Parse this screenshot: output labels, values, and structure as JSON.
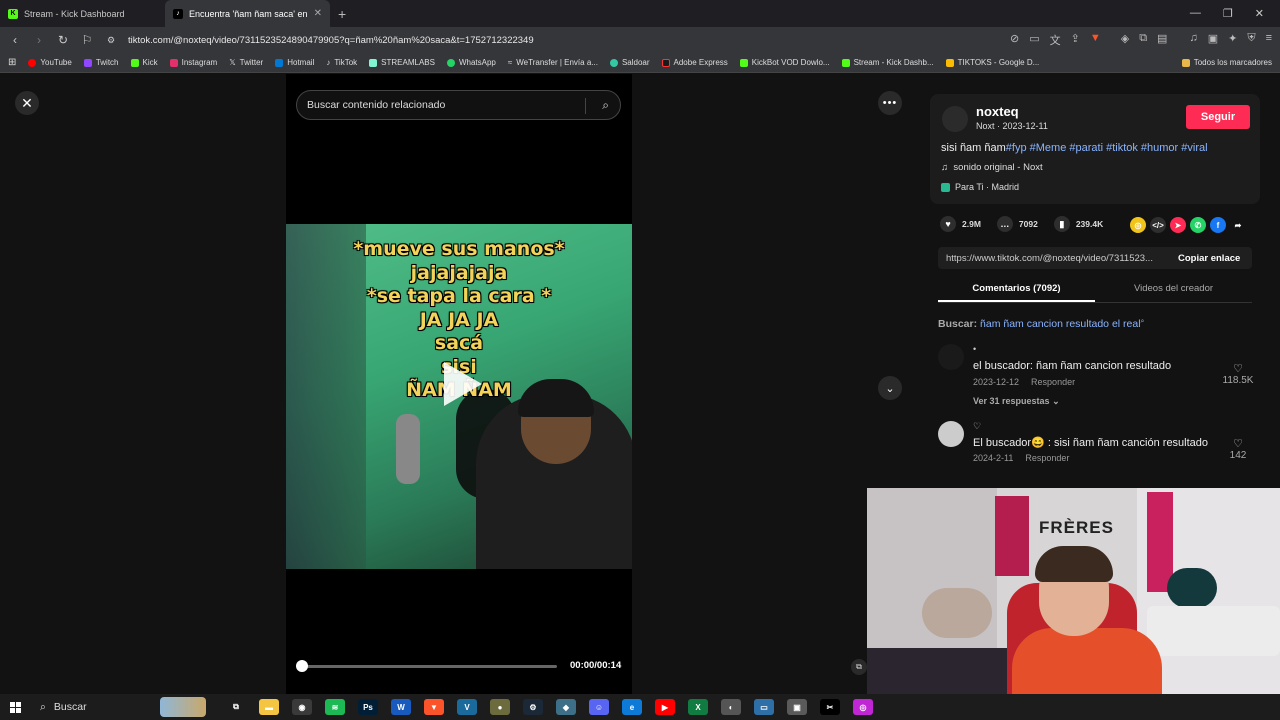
{
  "browser": {
    "tabs": [
      {
        "label": "Stream - Kick Dashboard",
        "active": false,
        "favicon_color": "#53fc18",
        "favicon_glyph": "K"
      },
      {
        "label": "Encuentra 'ñam ñam saca' en Tik",
        "active": true,
        "favicon_color": "#000000",
        "favicon_glyph": "♪"
      }
    ],
    "new_tab_glyph": "+",
    "url": "tiktok.com/@noxteq/video/7311523524890479905?q=ñam%20ñam%20saca&t=1752712322349",
    "bookmarks": [
      {
        "label": "YouTube",
        "color": "#ff0000"
      },
      {
        "label": "Twitch",
        "color": "#9146ff"
      },
      {
        "label": "Kick",
        "color": "#53fc18"
      },
      {
        "label": "Instagram",
        "color": "#e1306c"
      },
      {
        "label": "Twitter",
        "color": "#ffffff"
      },
      {
        "label": "Hotmail",
        "color": "#0078d4"
      },
      {
        "label": "TikTok",
        "color": "#ffffff"
      },
      {
        "label": "STREAMLABS",
        "color": "#80f5d2"
      },
      {
        "label": "WhatsApp",
        "color": "#25d366"
      },
      {
        "label": "WeTransfer | Envía a...",
        "color": "#ffffff"
      },
      {
        "label": "Saldoar",
        "color": "#35c7a3"
      },
      {
        "label": "Adobe Express",
        "color": "#ff0000"
      },
      {
        "label": "KickBot VOD Dowlo...",
        "color": "#53fc18"
      },
      {
        "label": "Stream - Kick Dashb...",
        "color": "#53fc18"
      },
      {
        "label": "TIKTOKS - Google D...",
        "color": "#fbbc04"
      }
    ],
    "bookmarks_folder": "Todos los marcadores"
  },
  "search": {
    "placeholder": "Buscar contenido relacionado"
  },
  "video": {
    "caption_lines": [
      "*mueve sus manos*",
      "jajajajaja",
      "*se tapa la cara *",
      "JA JA JA",
      "sacá",
      "sisi",
      "ÑAM ÑAM"
    ],
    "time": "00:00/00:14",
    "progress": 0.0
  },
  "author": {
    "username": "noxteq",
    "sub": "Noxt · 2023-12-11",
    "follow_label": "Seguir",
    "description_text": "sisi ñam ñam",
    "description_tags": "#fyp #Meme #parati #tiktok #humor #viral",
    "sound": "sonido original - Noxt",
    "location": "Para Ti · Madrid"
  },
  "stats": {
    "likes": "2.9M",
    "comments": "7092",
    "saves": "239.4K"
  },
  "share_icons": [
    {
      "name": "coin-icon",
      "color": "#f0c419",
      "glyph": "◎"
    },
    {
      "name": "embed-icon",
      "color": "#2e2e2e",
      "glyph": "</>"
    },
    {
      "name": "send-icon",
      "color": "#fe2c55",
      "glyph": "➤"
    },
    {
      "name": "whatsapp-icon",
      "color": "#25d366",
      "glyph": "✆"
    },
    {
      "name": "facebook-icon",
      "color": "#1877f2",
      "glyph": "f"
    },
    {
      "name": "forward-icon",
      "color": "#121212",
      "glyph": "➦"
    }
  ],
  "link": {
    "url": "https://www.tiktok.com/@noxteq/video/7311523...",
    "copy_label": "Copiar enlace"
  },
  "panel_tabs": {
    "comments": "Comentarios (7092)",
    "creator_videos": "Videos del creador"
  },
  "related_search": {
    "prefix": "Buscar:",
    "query": "ñam ñam cancion resultado el real"
  },
  "comments": [
    {
      "name": "•",
      "text": "el buscador: ñam ñam cancion resultado",
      "date": "2023-12-12",
      "reply": "Responder",
      "likes": "118.5K",
      "replies": "Ver 31 respuestas"
    },
    {
      "name": "♡",
      "text": "El buscador😄 : sisi ñam ñam canción resultado",
      "date": "2024-2-11",
      "reply": "Responder",
      "likes": "142"
    }
  ],
  "webcam": {
    "wall_text": "FRÈRES"
  },
  "taskbar": {
    "search_label": "Buscar",
    "apps": [
      {
        "name": "taskview-icon",
        "color": "#1c1c1c",
        "glyph": "⧉"
      },
      {
        "name": "explorer-icon",
        "color": "#f4c542",
        "glyph": "▬"
      },
      {
        "name": "obs-icon",
        "color": "#3a3a3a",
        "glyph": "◉"
      },
      {
        "name": "spotify-icon",
        "color": "#1db954",
        "glyph": "≋"
      },
      {
        "name": "photoshop-icon",
        "color": "#001e36",
        "glyph": "Ps"
      },
      {
        "name": "word-icon",
        "color": "#185abd",
        "glyph": "W"
      },
      {
        "name": "brave-icon",
        "color": "#fb542b",
        "glyph": "▼"
      },
      {
        "name": "vegas-icon",
        "color": "#1a6a9c",
        "glyph": "V"
      },
      {
        "name": "app-icon",
        "color": "#6b6b3d",
        "glyph": "●"
      },
      {
        "name": "steam-icon",
        "color": "#1b2838",
        "glyph": "⚙"
      },
      {
        "name": "app2-icon",
        "color": "#3d6f88",
        "glyph": "◆"
      },
      {
        "name": "discord-icon",
        "color": "#5865f2",
        "glyph": "☺"
      },
      {
        "name": "edge-icon",
        "color": "#0c7ad6",
        "glyph": "e"
      },
      {
        "name": "youtube-app-icon",
        "color": "#ff0000",
        "glyph": "▶"
      },
      {
        "name": "excel-icon",
        "color": "#107c41",
        "glyph": "X"
      },
      {
        "name": "app3-icon",
        "color": "#555555",
        "glyph": "◐"
      },
      {
        "name": "app4-icon",
        "color": "#2f6fa8",
        "glyph": "▭"
      },
      {
        "name": "app5-icon",
        "color": "#5a5a5a",
        "glyph": "▣"
      },
      {
        "name": "capcut-icon",
        "color": "#000000",
        "glyph": "✂"
      },
      {
        "name": "app6-icon",
        "color": "#c026d3",
        "glyph": "◎"
      }
    ]
  }
}
